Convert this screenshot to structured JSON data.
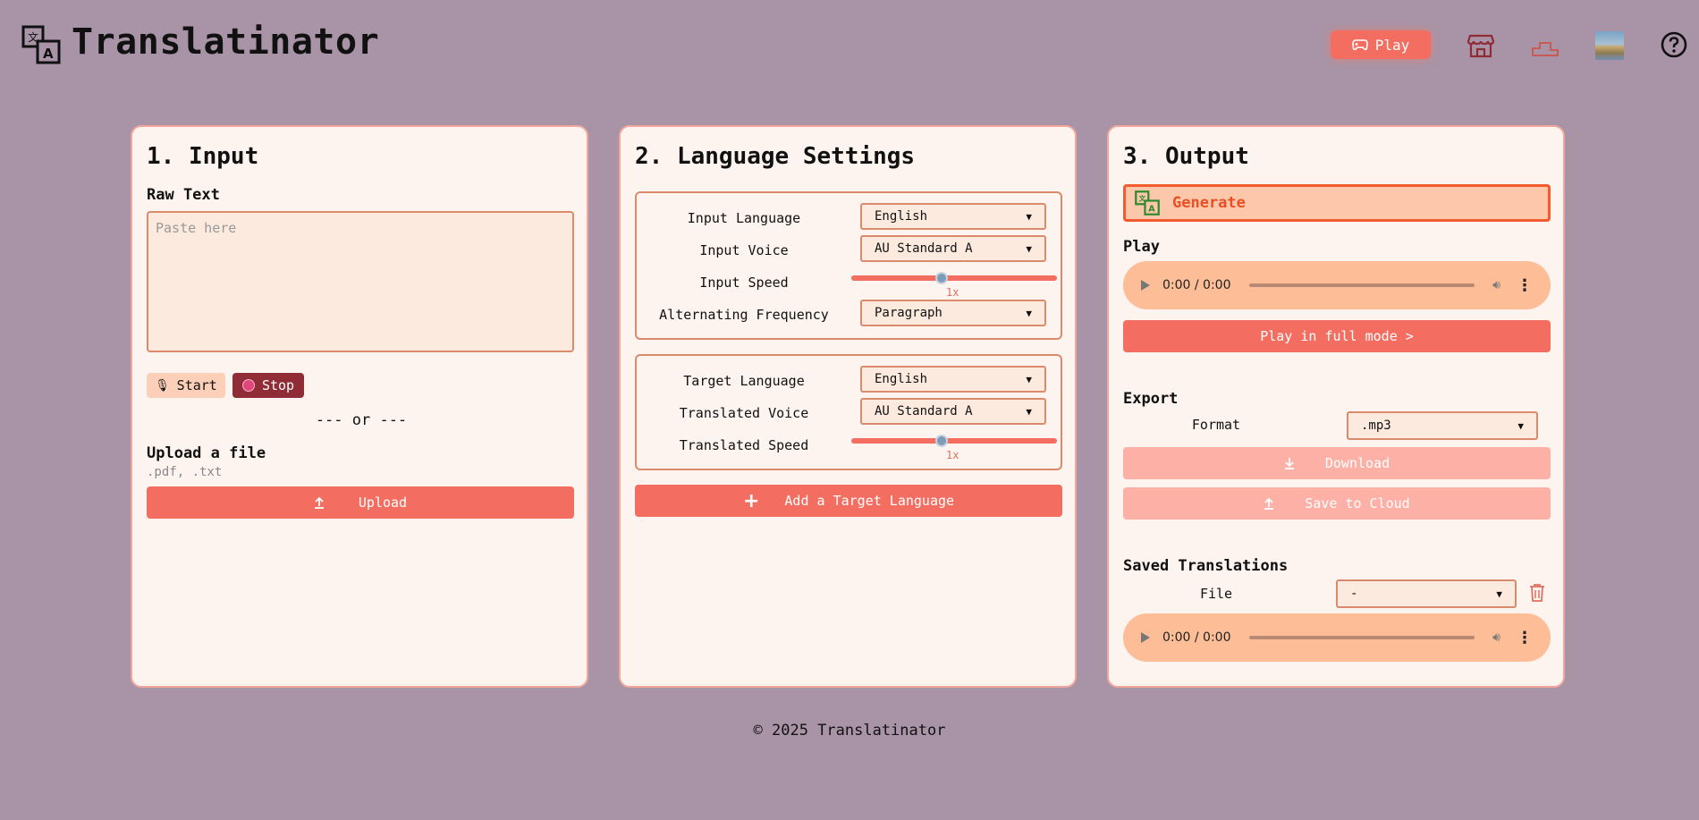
{
  "header": {
    "app_title": "Translatinator",
    "play_label": "Play",
    "nav_icons": [
      "translate-icon",
      "gamepad-icon",
      "store-icon",
      "podium-icon",
      "avatar",
      "help-icon"
    ]
  },
  "input_panel": {
    "title": "1. Input",
    "raw_text_label": "Raw Text",
    "raw_text_placeholder": "Paste here",
    "start_label": "Start",
    "stop_label": "Stop",
    "or_divider": "--- or ---",
    "upload_label": "Upload a file",
    "upload_hint": ".pdf, .txt",
    "upload_button": "Upload"
  },
  "language_panel": {
    "title": "2. Language Settings",
    "input_group": {
      "language_label": "Input Language",
      "language_value": "English",
      "voice_label": "Input Voice",
      "voice_value": "AU Standard A",
      "speed_label": "Input Speed",
      "speed_value": "1x",
      "speed_fraction": 0.44,
      "frequency_label": "Alternating Frequency",
      "frequency_value": "Paragraph"
    },
    "target_group": {
      "language_label": "Target Language",
      "language_value": "English",
      "voice_label": "Translated Voice",
      "voice_value": "AU Standard A",
      "speed_label": "Translated Speed",
      "speed_value": "1x",
      "speed_fraction": 0.44
    },
    "add_target_button": "Add a Target Language"
  },
  "output_panel": {
    "title": "3. Output",
    "generate_label": "Generate",
    "play_label": "Play",
    "audio_time": "0:00 / 0:00",
    "full_mode_button": "Play in full mode >",
    "export_label": "Export",
    "format_label": "Format",
    "format_value": ".mp3",
    "download_button": "Download",
    "save_cloud_button": "Save to Cloud",
    "saved_label": "Saved Translations",
    "file_label": "File",
    "file_value": "-",
    "saved_audio_time": "0:00 / 0:00"
  },
  "footer": {
    "copyright": "© 2025 Translatinator"
  },
  "colors": {
    "background": "#a894a6",
    "accent": "#f36e60",
    "panel": "#fdf3ef",
    "panel_border": "#f3a79a"
  }
}
